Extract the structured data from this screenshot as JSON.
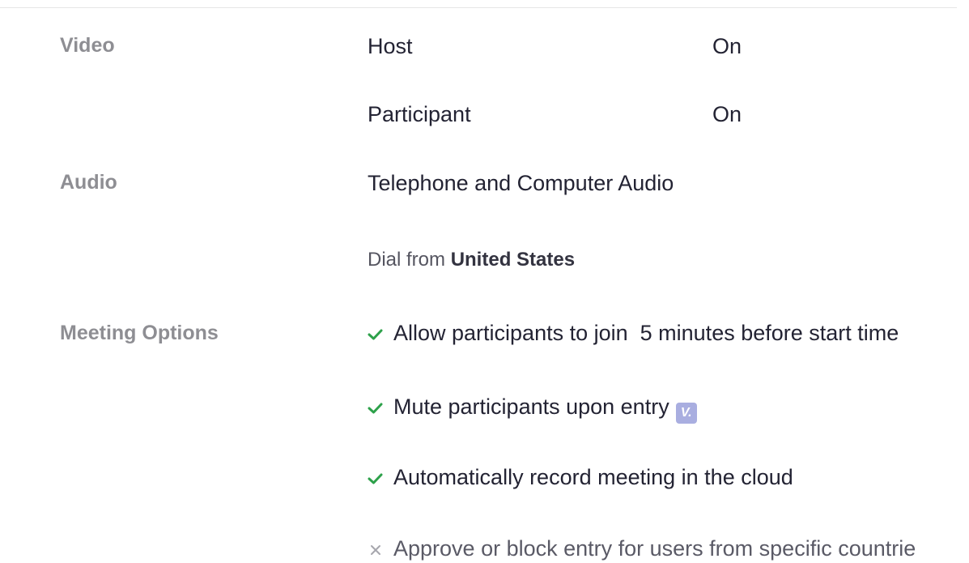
{
  "sections": {
    "video": {
      "label": "Video",
      "rows": [
        {
          "name": "Host",
          "value": "On"
        },
        {
          "name": "Participant",
          "value": "On"
        }
      ]
    },
    "audio": {
      "label": "Audio",
      "value": "Telephone and Computer Audio",
      "dial_from_prefix": "Dial from",
      "dial_from_country": "United States"
    },
    "meeting_options": {
      "label": "Meeting Options",
      "options": [
        {
          "text": "Allow participants to join  5 minutes before start time",
          "enabled": true
        },
        {
          "text": "Mute participants upon entry",
          "enabled": true,
          "badge": "V."
        },
        {
          "text": "Automatically record meeting in the cloud",
          "enabled": true
        },
        {
          "text": "Approve or block entry for users from specific countrie",
          "enabled": false
        }
      ]
    }
  },
  "icons": {
    "enabled": "check-icon",
    "disabled": "close-icon",
    "badge": "version-badge-icon"
  },
  "colors": {
    "check": "#2da14a",
    "cross": "#a6a6ad",
    "label": "#8e8e93",
    "text": "#232333",
    "badge": "#a9aee0"
  }
}
